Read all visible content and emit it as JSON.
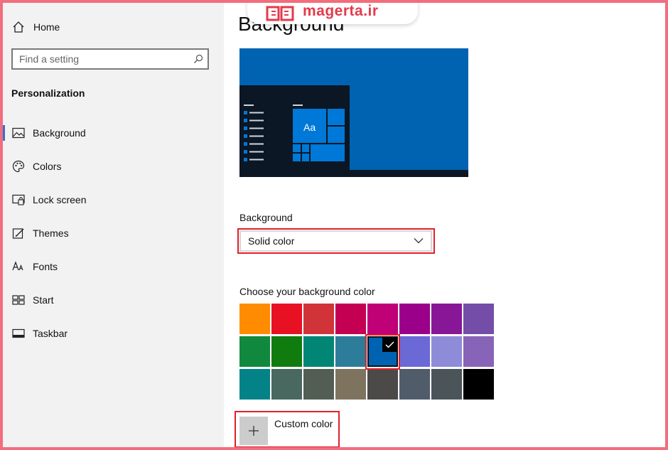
{
  "watermark": {
    "text": "magerta.ir"
  },
  "sidebar": {
    "home_label": "Home",
    "search_placeholder": "Find a setting",
    "section_title": "Personalization",
    "items": [
      {
        "label": "Background",
        "icon": "image-icon",
        "active": true
      },
      {
        "label": "Colors",
        "icon": "palette-icon"
      },
      {
        "label": "Lock screen",
        "icon": "lock-screen-icon"
      },
      {
        "label": "Themes",
        "icon": "brush-icon"
      },
      {
        "label": "Fonts",
        "icon": "font-icon"
      },
      {
        "label": "Start",
        "icon": "start-icon"
      },
      {
        "label": "Taskbar",
        "icon": "taskbar-icon"
      }
    ]
  },
  "main": {
    "title": "Background",
    "preview_tile_label": "Aa",
    "background_label": "Background",
    "background_value": "Solid color",
    "color_label": "Choose your background color",
    "custom_color_label": "Custom color",
    "swatches": [
      "#ff8c00",
      "#e81123",
      "#d13438",
      "#c30052",
      "#bf0077",
      "#9a0089",
      "#881798",
      "#744da9",
      "#10893e",
      "#107c10",
      "#018574",
      "#2d7d9a",
      "#0063b1",
      "#6b69d6",
      "#8e8cd8",
      "#8764b8",
      "#038387",
      "#486860",
      "#525e54",
      "#7e735f",
      "#4c4a48",
      "#515c6b",
      "#4a5459",
      "#000000"
    ],
    "selected_swatch": "#0063b1"
  },
  "colors": {
    "accent": "#0063b1",
    "highlight": "#e0202a",
    "sidebar_bg": "#f2f2f2"
  }
}
